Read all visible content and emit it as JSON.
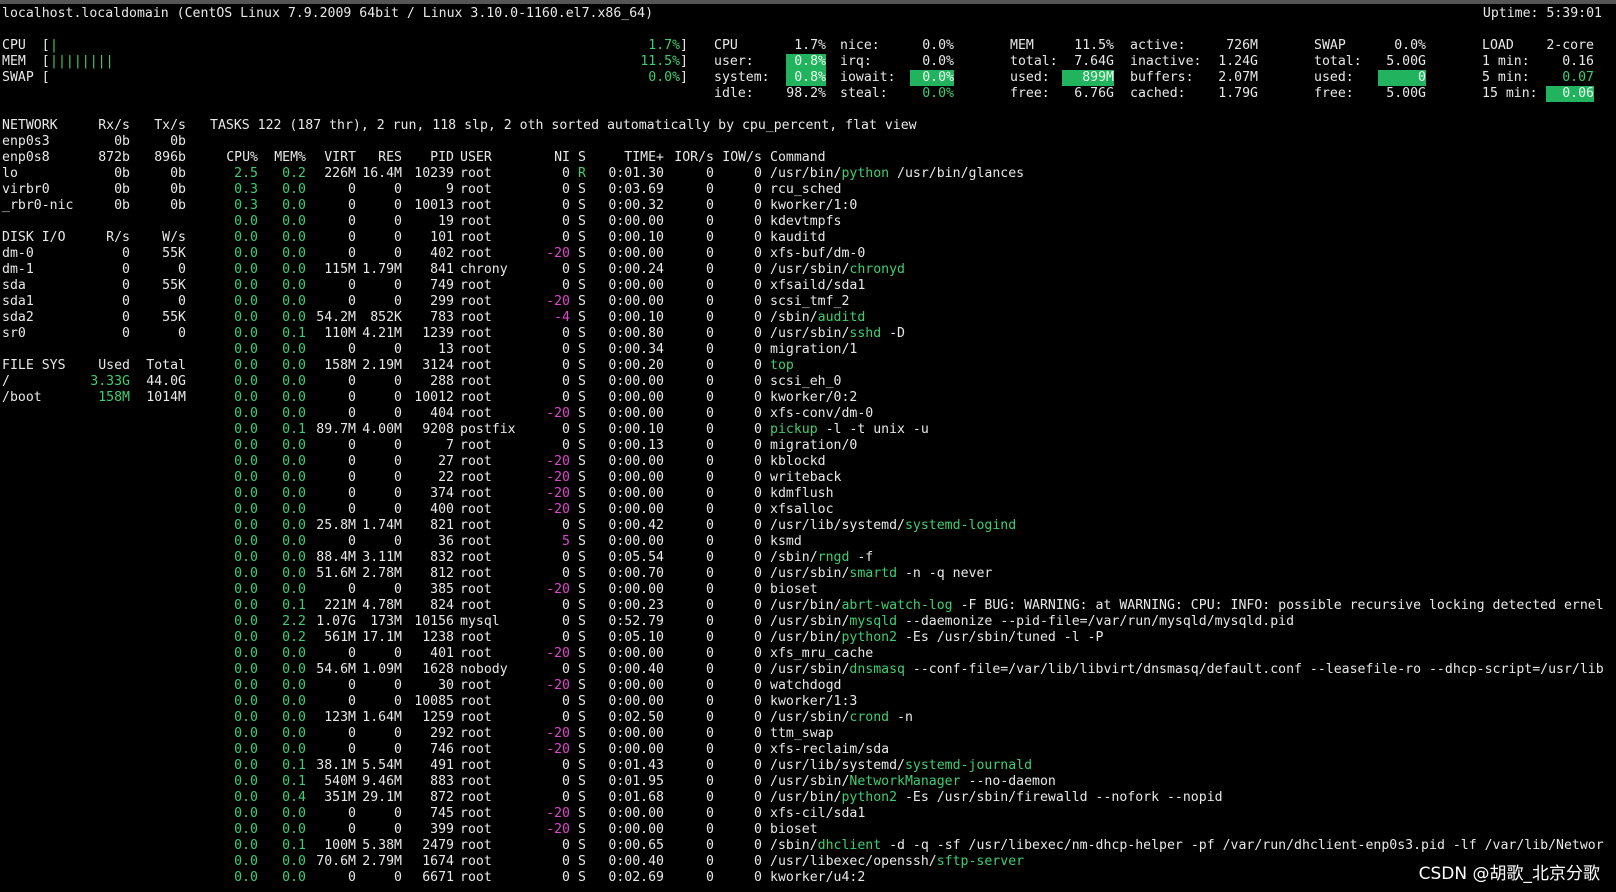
{
  "header": {
    "host": "localhost.localdomain (CentOS Linux 7.9.2009 64bit / Linux 3.10.0-1160.el7.x86_64)",
    "uptime": "Uptime: 5:39:01"
  },
  "bars": {
    "cpu_label": "CPU  [",
    "cpu_bar": "|",
    "cpu_pct": "1.7%]",
    "mem_label": "MEM  [",
    "mem_bar": "||||||||",
    "mem_pct": "11.5%]",
    "swap_label": "SWAP [",
    "swap_pct": "0.0%]"
  },
  "cpu": {
    "title": "CPU",
    "total": "1.7%",
    "user_l": "user:",
    "user": "0.8%",
    "system_l": "system:",
    "system": "0.8%",
    "idle_l": "idle:",
    "idle": "98.2%",
    "nice_l": "nice:",
    "nice": "0.0%",
    "irq_l": "irq:",
    "irq": "0.0%",
    "iowait_l": "iowait:",
    "iowait": "0.0%",
    "steal_l": "steal:",
    "steal": "0.0%"
  },
  "mem": {
    "title": "MEM",
    "total_pct": "11.5%",
    "total_l": "total:",
    "total": "7.64G",
    "used_l": "used:",
    "used": "899M",
    "free_l": "free:",
    "free": "6.76G",
    "active_l": "active:",
    "active": "726M",
    "inactive_l": "inactive:",
    "inactive": "1.24G",
    "buffers_l": "buffers:",
    "buffers": "2.07M",
    "cached_l": "cached:",
    "cached": "1.79G"
  },
  "swap": {
    "title": "SWAP",
    "pct": "0.0%",
    "total_l": "total:",
    "total": "5.00G",
    "used_l": "used:",
    "used": "0",
    "free_l": "free:",
    "free": "5.00G"
  },
  "load": {
    "title": "LOAD",
    "cores": "2-core",
    "m1_l": "1 min:",
    "m1": "0.16",
    "m5_l": "5 min:",
    "m5": "0.07",
    "m15_l": "15 min:",
    "m15": "0.06"
  },
  "network": {
    "headers": [
      "NETWORK",
      "Rx/s",
      "Tx/s"
    ],
    "rows": [
      [
        "enp0s3",
        "0b",
        "0b"
      ],
      [
        "enp0s8",
        "872b",
        "896b"
      ],
      [
        "lo",
        "0b",
        "0b"
      ],
      [
        "virbr0",
        "0b",
        "0b"
      ],
      [
        "_rbr0-nic",
        "0b",
        "0b"
      ]
    ]
  },
  "disk": {
    "headers": [
      "DISK I/O",
      "R/s",
      "W/s"
    ],
    "rows": [
      [
        "dm-0",
        "0",
        "55K"
      ],
      [
        "dm-1",
        "0",
        "0"
      ],
      [
        "sda",
        "0",
        "55K"
      ],
      [
        "sda1",
        "0",
        "0"
      ],
      [
        "sda2",
        "0",
        "55K"
      ],
      [
        "sr0",
        "0",
        "0"
      ]
    ]
  },
  "fs": {
    "headers": [
      "FILE SYS",
      "Used",
      "Total"
    ],
    "rows": [
      [
        "/",
        "3.33G",
        "44.0G"
      ],
      [
        "/boot",
        "158M",
        "1014M"
      ]
    ]
  },
  "tasks_line": "TASKS 122 (187 thr), 2 run, 118 slp, 2 oth sorted automatically by cpu_percent, flat view",
  "proc_headers": [
    "CPU%",
    "MEM%",
    "VIRT",
    "RES",
    "PID",
    "USER",
    "NI",
    "S",
    "TIME+",
    "IOR/s",
    "IOW/s",
    "Command"
  ],
  "processes": [
    {
      "cpu": "2.5",
      "mem": "0.2",
      "virt": "226M",
      "res": "16.4M",
      "pid": "10239",
      "user": "root",
      "ni": "0",
      "s": "R",
      "time": "0:01.30",
      "ior": "0",
      "iow": "0",
      "cmd_pre": "/usr/bin/",
      "cmd_hl": "python",
      "cmd_post": " /usr/bin/glances"
    },
    {
      "cpu": "0.3",
      "mem": "0.0",
      "virt": "0",
      "res": "0",
      "pid": "9",
      "user": "root",
      "ni": "0",
      "s": "S",
      "time": "0:03.69",
      "ior": "0",
      "iow": "0",
      "cmd_pre": "rcu_sched",
      "cmd_hl": "",
      "cmd_post": ""
    },
    {
      "cpu": "0.3",
      "mem": "0.0",
      "virt": "0",
      "res": "0",
      "pid": "10013",
      "user": "root",
      "ni": "0",
      "s": "S",
      "time": "0:00.32",
      "ior": "0",
      "iow": "0",
      "cmd_pre": "kworker/1:0",
      "cmd_hl": "",
      "cmd_post": ""
    },
    {
      "cpu": "0.0",
      "mem": "0.0",
      "virt": "0",
      "res": "0",
      "pid": "19",
      "user": "root",
      "ni": "0",
      "s": "S",
      "time": "0:00.00",
      "ior": "0",
      "iow": "0",
      "cmd_pre": "kdevtmpfs",
      "cmd_hl": "",
      "cmd_post": ""
    },
    {
      "cpu": "0.0",
      "mem": "0.0",
      "virt": "0",
      "res": "0",
      "pid": "101",
      "user": "root",
      "ni": "0",
      "s": "S",
      "time": "0:00.10",
      "ior": "0",
      "iow": "0",
      "cmd_pre": "kauditd",
      "cmd_hl": "",
      "cmd_post": ""
    },
    {
      "cpu": "0.0",
      "mem": "0.0",
      "virt": "0",
      "res": "0",
      "pid": "402",
      "user": "root",
      "ni": "-20",
      "s": "S",
      "time": "0:00.00",
      "ior": "0",
      "iow": "0",
      "cmd_pre": "xfs-buf/dm-0",
      "cmd_hl": "",
      "cmd_post": ""
    },
    {
      "cpu": "0.0",
      "mem": "0.0",
      "virt": "115M",
      "res": "1.79M",
      "pid": "841",
      "user": "chrony",
      "ni": "0",
      "s": "S",
      "time": "0:00.24",
      "ior": "0",
      "iow": "0",
      "cmd_pre": "/usr/sbin/",
      "cmd_hl": "chronyd",
      "cmd_post": ""
    },
    {
      "cpu": "0.0",
      "mem": "0.0",
      "virt": "0",
      "res": "0",
      "pid": "749",
      "user": "root",
      "ni": "0",
      "s": "S",
      "time": "0:00.00",
      "ior": "0",
      "iow": "0",
      "cmd_pre": "xfsaild/sda1",
      "cmd_hl": "",
      "cmd_post": ""
    },
    {
      "cpu": "0.0",
      "mem": "0.0",
      "virt": "0",
      "res": "0",
      "pid": "299",
      "user": "root",
      "ni": "-20",
      "s": "S",
      "time": "0:00.00",
      "ior": "0",
      "iow": "0",
      "cmd_pre": "scsi_tmf_2",
      "cmd_hl": "",
      "cmd_post": ""
    },
    {
      "cpu": "0.0",
      "mem": "0.0",
      "virt": "54.2M",
      "res": "852K",
      "pid": "783",
      "user": "root",
      "ni": "-4",
      "s": "S",
      "time": "0:00.10",
      "ior": "0",
      "iow": "0",
      "cmd_pre": "/sbin/",
      "cmd_hl": "auditd",
      "cmd_post": ""
    },
    {
      "cpu": "0.0",
      "mem": "0.1",
      "virt": "110M",
      "res": "4.21M",
      "pid": "1239",
      "user": "root",
      "ni": "0",
      "s": "S",
      "time": "0:00.80",
      "ior": "0",
      "iow": "0",
      "cmd_pre": "/usr/sbin/",
      "cmd_hl": "sshd",
      "cmd_post": " -D"
    },
    {
      "cpu": "0.0",
      "mem": "0.0",
      "virt": "0",
      "res": "0",
      "pid": "13",
      "user": "root",
      "ni": "0",
      "s": "S",
      "time": "0:00.34",
      "ior": "0",
      "iow": "0",
      "cmd_pre": "migration/1",
      "cmd_hl": "",
      "cmd_post": ""
    },
    {
      "cpu": "0.0",
      "mem": "0.0",
      "virt": "158M",
      "res": "2.19M",
      "pid": "3124",
      "user": "root",
      "ni": "0",
      "s": "S",
      "time": "0:00.20",
      "ior": "0",
      "iow": "0",
      "cmd_pre": "",
      "cmd_hl": "top",
      "cmd_post": ""
    },
    {
      "cpu": "0.0",
      "mem": "0.0",
      "virt": "0",
      "res": "0",
      "pid": "288",
      "user": "root",
      "ni": "0",
      "s": "S",
      "time": "0:00.00",
      "ior": "0",
      "iow": "0",
      "cmd_pre": "scsi_eh_0",
      "cmd_hl": "",
      "cmd_post": ""
    },
    {
      "cpu": "0.0",
      "mem": "0.0",
      "virt": "0",
      "res": "0",
      "pid": "10012",
      "user": "root",
      "ni": "0",
      "s": "S",
      "time": "0:00.00",
      "ior": "0",
      "iow": "0",
      "cmd_pre": "kworker/0:2",
      "cmd_hl": "",
      "cmd_post": ""
    },
    {
      "cpu": "0.0",
      "mem": "0.0",
      "virt": "0",
      "res": "0",
      "pid": "404",
      "user": "root",
      "ni": "-20",
      "s": "S",
      "time": "0:00.00",
      "ior": "0",
      "iow": "0",
      "cmd_pre": "xfs-conv/dm-0",
      "cmd_hl": "",
      "cmd_post": ""
    },
    {
      "cpu": "0.0",
      "mem": "0.1",
      "virt": "89.7M",
      "res": "4.00M",
      "pid": "9208",
      "user": "postfix",
      "ni": "0",
      "s": "S",
      "time": "0:00.10",
      "ior": "0",
      "iow": "0",
      "cmd_pre": "",
      "cmd_hl": "pickup",
      "cmd_post": " -l -t unix -u"
    },
    {
      "cpu": "0.0",
      "mem": "0.0",
      "virt": "0",
      "res": "0",
      "pid": "7",
      "user": "root",
      "ni": "0",
      "s": "S",
      "time": "0:00.13",
      "ior": "0",
      "iow": "0",
      "cmd_pre": "migration/0",
      "cmd_hl": "",
      "cmd_post": ""
    },
    {
      "cpu": "0.0",
      "mem": "0.0",
      "virt": "0",
      "res": "0",
      "pid": "27",
      "user": "root",
      "ni": "-20",
      "s": "S",
      "time": "0:00.00",
      "ior": "0",
      "iow": "0",
      "cmd_pre": "kblockd",
      "cmd_hl": "",
      "cmd_post": ""
    },
    {
      "cpu": "0.0",
      "mem": "0.0",
      "virt": "0",
      "res": "0",
      "pid": "22",
      "user": "root",
      "ni": "-20",
      "s": "S",
      "time": "0:00.00",
      "ior": "0",
      "iow": "0",
      "cmd_pre": "writeback",
      "cmd_hl": "",
      "cmd_post": ""
    },
    {
      "cpu": "0.0",
      "mem": "0.0",
      "virt": "0",
      "res": "0",
      "pid": "374",
      "user": "root",
      "ni": "-20",
      "s": "S",
      "time": "0:00.00",
      "ior": "0",
      "iow": "0",
      "cmd_pre": "kdmflush",
      "cmd_hl": "",
      "cmd_post": ""
    },
    {
      "cpu": "0.0",
      "mem": "0.0",
      "virt": "0",
      "res": "0",
      "pid": "400",
      "user": "root",
      "ni": "-20",
      "s": "S",
      "time": "0:00.00",
      "ior": "0",
      "iow": "0",
      "cmd_pre": "xfsalloc",
      "cmd_hl": "",
      "cmd_post": ""
    },
    {
      "cpu": "0.0",
      "mem": "0.0",
      "virt": "25.8M",
      "res": "1.74M",
      "pid": "821",
      "user": "root",
      "ni": "0",
      "s": "S",
      "time": "0:00.42",
      "ior": "0",
      "iow": "0",
      "cmd_pre": "/usr/lib/systemd/",
      "cmd_hl": "systemd-logind",
      "cmd_post": ""
    },
    {
      "cpu": "0.0",
      "mem": "0.0",
      "virt": "0",
      "res": "0",
      "pid": "36",
      "user": "root",
      "ni": "5",
      "s": "S",
      "time": "0:00.00",
      "ior": "0",
      "iow": "0",
      "cmd_pre": "ksmd",
      "cmd_hl": "",
      "cmd_post": ""
    },
    {
      "cpu": "0.0",
      "mem": "0.0",
      "virt": "88.4M",
      "res": "3.11M",
      "pid": "832",
      "user": "root",
      "ni": "0",
      "s": "S",
      "time": "0:05.54",
      "ior": "0",
      "iow": "0",
      "cmd_pre": "/sbin/",
      "cmd_hl": "rngd",
      "cmd_post": " -f"
    },
    {
      "cpu": "0.0",
      "mem": "0.0",
      "virt": "51.6M",
      "res": "2.78M",
      "pid": "812",
      "user": "root",
      "ni": "0",
      "s": "S",
      "time": "0:00.70",
      "ior": "0",
      "iow": "0",
      "cmd_pre": "/usr/sbin/",
      "cmd_hl": "smartd",
      "cmd_post": " -n -q never"
    },
    {
      "cpu": "0.0",
      "mem": "0.0",
      "virt": "0",
      "res": "0",
      "pid": "385",
      "user": "root",
      "ni": "-20",
      "s": "S",
      "time": "0:00.00",
      "ior": "0",
      "iow": "0",
      "cmd_pre": "bioset",
      "cmd_hl": "",
      "cmd_post": ""
    },
    {
      "cpu": "0.0",
      "mem": "0.1",
      "virt": "221M",
      "res": "4.78M",
      "pid": "824",
      "user": "root",
      "ni": "0",
      "s": "S",
      "time": "0:00.23",
      "ior": "0",
      "iow": "0",
      "cmd_pre": "/usr/bin/",
      "cmd_hl": "abrt-watch-log",
      "cmd_post": " -F BUG: WARNING: at WARNING: CPU: INFO: possible recursive locking detected ernel"
    },
    {
      "cpu": "0.0",
      "mem": "2.2",
      "virt": "1.07G",
      "res": "173M",
      "pid": "10156",
      "user": "mysql",
      "ni": "0",
      "s": "S",
      "time": "0:52.79",
      "ior": "0",
      "iow": "0",
      "cmd_pre": "/usr/sbin/",
      "cmd_hl": "mysqld",
      "cmd_post": " --daemonize --pid-file=/var/run/mysqld/mysqld.pid"
    },
    {
      "cpu": "0.0",
      "mem": "0.2",
      "virt": "561M",
      "res": "17.1M",
      "pid": "1238",
      "user": "root",
      "ni": "0",
      "s": "S",
      "time": "0:05.10",
      "ior": "0",
      "iow": "0",
      "cmd_pre": "/usr/bin/",
      "cmd_hl": "python2",
      "cmd_post": " -Es /usr/sbin/tuned -l -P"
    },
    {
      "cpu": "0.0",
      "mem": "0.0",
      "virt": "0",
      "res": "0",
      "pid": "401",
      "user": "root",
      "ni": "-20",
      "s": "S",
      "time": "0:00.00",
      "ior": "0",
      "iow": "0",
      "cmd_pre": "xfs_mru_cache",
      "cmd_hl": "",
      "cmd_post": ""
    },
    {
      "cpu": "0.0",
      "mem": "0.0",
      "virt": "54.6M",
      "res": "1.09M",
      "pid": "1628",
      "user": "nobody",
      "ni": "0",
      "s": "S",
      "time": "0:00.40",
      "ior": "0",
      "iow": "0",
      "cmd_pre": "/usr/sbin/",
      "cmd_hl": "dnsmasq",
      "cmd_post": " --conf-file=/var/lib/libvirt/dnsmasq/default.conf --leasefile-ro --dhcp-script=/usr/lib"
    },
    {
      "cpu": "0.0",
      "mem": "0.0",
      "virt": "0",
      "res": "0",
      "pid": "30",
      "user": "root",
      "ni": "-20",
      "s": "S",
      "time": "0:00.00",
      "ior": "0",
      "iow": "0",
      "cmd_pre": "watchdogd",
      "cmd_hl": "",
      "cmd_post": ""
    },
    {
      "cpu": "0.0",
      "mem": "0.0",
      "virt": "0",
      "res": "0",
      "pid": "10085",
      "user": "root",
      "ni": "0",
      "s": "S",
      "time": "0:00.00",
      "ior": "0",
      "iow": "0",
      "cmd_pre": "kworker/1:3",
      "cmd_hl": "",
      "cmd_post": ""
    },
    {
      "cpu": "0.0",
      "mem": "0.0",
      "virt": "123M",
      "res": "1.64M",
      "pid": "1259",
      "user": "root",
      "ni": "0",
      "s": "S",
      "time": "0:02.50",
      "ior": "0",
      "iow": "0",
      "cmd_pre": "/usr/sbin/",
      "cmd_hl": "crond",
      "cmd_post": " -n"
    },
    {
      "cpu": "0.0",
      "mem": "0.0",
      "virt": "0",
      "res": "0",
      "pid": "292",
      "user": "root",
      "ni": "-20",
      "s": "S",
      "time": "0:00.00",
      "ior": "0",
      "iow": "0",
      "cmd_pre": "ttm_swap",
      "cmd_hl": "",
      "cmd_post": ""
    },
    {
      "cpu": "0.0",
      "mem": "0.0",
      "virt": "0",
      "res": "0",
      "pid": "746",
      "user": "root",
      "ni": "-20",
      "s": "S",
      "time": "0:00.00",
      "ior": "0",
      "iow": "0",
      "cmd_pre": "xfs-reclaim/sda",
      "cmd_hl": "",
      "cmd_post": ""
    },
    {
      "cpu": "0.0",
      "mem": "0.1",
      "virt": "38.1M",
      "res": "5.54M",
      "pid": "491",
      "user": "root",
      "ni": "0",
      "s": "S",
      "time": "0:01.43",
      "ior": "0",
      "iow": "0",
      "cmd_pre": "/usr/lib/systemd/",
      "cmd_hl": "systemd-journald",
      "cmd_post": ""
    },
    {
      "cpu": "0.0",
      "mem": "0.1",
      "virt": "540M",
      "res": "9.46M",
      "pid": "883",
      "user": "root",
      "ni": "0",
      "s": "S",
      "time": "0:01.95",
      "ior": "0",
      "iow": "0",
      "cmd_pre": "/usr/sbin/",
      "cmd_hl": "NetworkManager",
      "cmd_post": " --no-daemon"
    },
    {
      "cpu": "0.0",
      "mem": "0.4",
      "virt": "351M",
      "res": "29.1M",
      "pid": "872",
      "user": "root",
      "ni": "0",
      "s": "S",
      "time": "0:01.68",
      "ior": "0",
      "iow": "0",
      "cmd_pre": "/usr/bin/",
      "cmd_hl": "python2",
      "cmd_post": " -Es /usr/sbin/firewalld --nofork --nopid"
    },
    {
      "cpu": "0.0",
      "mem": "0.0",
      "virt": "0",
      "res": "0",
      "pid": "745",
      "user": "root",
      "ni": "-20",
      "s": "S",
      "time": "0:00.00",
      "ior": "0",
      "iow": "0",
      "cmd_pre": "xfs-cil/sda1",
      "cmd_hl": "",
      "cmd_post": ""
    },
    {
      "cpu": "0.0",
      "mem": "0.0",
      "virt": "0",
      "res": "0",
      "pid": "399",
      "user": "root",
      "ni": "-20",
      "s": "S",
      "time": "0:00.00",
      "ior": "0",
      "iow": "0",
      "cmd_pre": "bioset",
      "cmd_hl": "",
      "cmd_post": ""
    },
    {
      "cpu": "0.0",
      "mem": "0.1",
      "virt": "100M",
      "res": "5.38M",
      "pid": "2479",
      "user": "root",
      "ni": "0",
      "s": "S",
      "time": "0:00.65",
      "ior": "0",
      "iow": "0",
      "cmd_pre": "/sbin/",
      "cmd_hl": "dhclient",
      "cmd_post": " -d -q -sf /usr/libexec/nm-dhcp-helper -pf /var/run/dhclient-enp0s3.pid -lf /var/lib/Networ"
    },
    {
      "cpu": "0.0",
      "mem": "0.0",
      "virt": "70.6M",
      "res": "2.79M",
      "pid": "1674",
      "user": "root",
      "ni": "0",
      "s": "S",
      "time": "0:00.40",
      "ior": "0",
      "iow": "0",
      "cmd_pre": "/usr/libexec/openssh/",
      "cmd_hl": "sftp-server",
      "cmd_post": ""
    },
    {
      "cpu": "0.0",
      "mem": "0.0",
      "virt": "0",
      "res": "0",
      "pid": "6671",
      "user": "root",
      "ni": "0",
      "s": "S",
      "time": "0:02.69",
      "ior": "0",
      "iow": "0",
      "cmd_pre": "kworker/u4:2",
      "cmd_hl": "",
      "cmd_post": ""
    }
  ],
  "watermark": "CSDN @胡歌_北京分歌",
  "colors": {
    "accent_green": "#3ecf6f",
    "highlight_green": "#21b35e",
    "nice_magenta": "#e045d0",
    "background": "#000000"
  }
}
